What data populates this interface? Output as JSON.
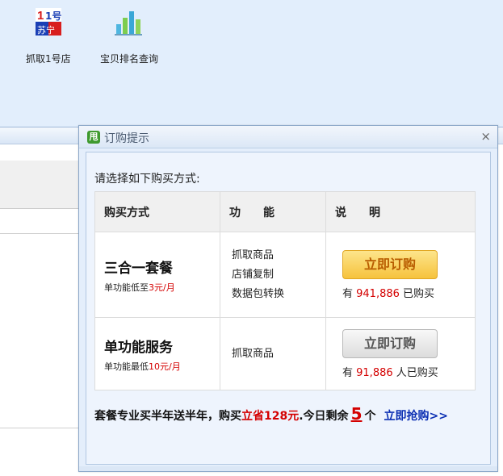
{
  "toolbar": {
    "items": [
      {
        "label": "抓取1号店",
        "icon": "yhd-logo-icon",
        "icon_top": "1号",
        "icon_bottom": "苏宁"
      },
      {
        "label": "宝贝排名查询",
        "icon": "bar-chart-icon"
      }
    ]
  },
  "dialog": {
    "logo_char": "甩",
    "title": "订购提示",
    "close": "×",
    "prompt": "请选择如下购买方式:",
    "headers": [
      "购买方式",
      "功　　能",
      "说　　明"
    ],
    "rows": [
      {
        "name": "三合一套餐",
        "sub_prefix": "单功能低至",
        "sub_price": "3元/月",
        "features": [
          "抓取商品",
          "店铺复制",
          "数据包转换"
        ],
        "button": "立即订购",
        "count_prefix": "有 ",
        "count": "941,886",
        "count_suffix": " 已购买"
      },
      {
        "name": "单功能服务",
        "sub_prefix": "单功能最低",
        "sub_price": "10元/月",
        "features": [
          "抓取商品"
        ],
        "button": "立即订购",
        "count_prefix": "有 ",
        "count": "91,886",
        "count_suffix": " 人已购买"
      }
    ],
    "footer": {
      "text1": "套餐专业买半年送半年，购买",
      "save": "立省128元",
      "text2": ".今日剩余",
      "remaining": "5",
      "text3": "个",
      "link": "立即抢购>>"
    }
  },
  "colors": {
    "accent_red": "#d40000",
    "link_blue": "#0b2fb3",
    "gold_button": "#f6c33d",
    "toolbar_bg": "#e2eefc"
  }
}
